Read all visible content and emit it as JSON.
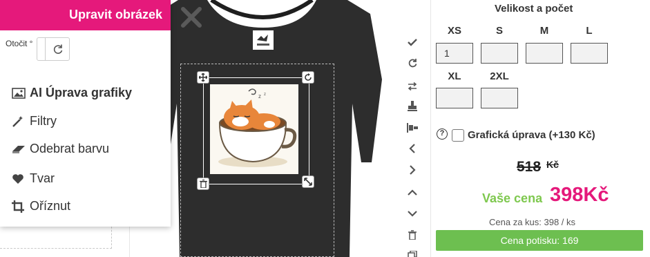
{
  "edit_panel": {
    "title": "Upravit obrázek",
    "rotate_label": "Otočit °",
    "menu": [
      {
        "label": "AI Úprava grafiky",
        "icon": "image-icon"
      },
      {
        "label": "Filtry",
        "icon": "magic-wand-icon"
      },
      {
        "label": "Odebrat barvu",
        "icon": "eraser-icon"
      },
      {
        "label": "Tvar",
        "icon": "heart-icon"
      },
      {
        "label": "Oříznut",
        "icon": "crop-icon"
      }
    ]
  },
  "canvas": {
    "shirt_color": "#2a2a2a",
    "accent_color": "#e5197b"
  },
  "toolbar": {
    "icons": [
      "check-icon",
      "refresh-icon",
      "swap-icon",
      "stamp-icon",
      "align-icon",
      "chevron-left-icon",
      "chevron-right-icon",
      "chevron-up-icon",
      "chevron-down-icon",
      "trash-icon",
      "copy-icon"
    ]
  },
  "size": {
    "title": "Velikost a počet",
    "sizes": [
      {
        "label": "XS",
        "value": "1"
      },
      {
        "label": "S",
        "value": ""
      },
      {
        "label": "M",
        "value": ""
      },
      {
        "label": "L",
        "value": ""
      },
      {
        "label": "XL",
        "value": ""
      },
      {
        "label": "2XL",
        "value": ""
      }
    ]
  },
  "graphic": {
    "help": "?",
    "label": "Grafická úprava (+130 Kč)",
    "checked": false
  },
  "price": {
    "old_value": "518",
    "old_currency": "Kč",
    "your_label": "Vaše cena",
    "your_value": "398Kč",
    "unit_price": "Cena za kus: 398 / ks",
    "print_price": "Cena potisku: 169"
  }
}
